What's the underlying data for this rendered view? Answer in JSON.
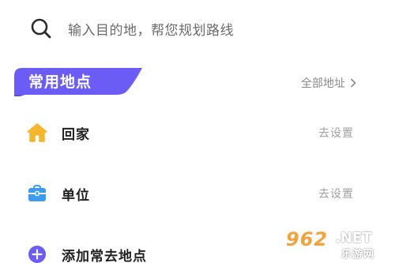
{
  "search": {
    "placeholder": "输入目的地，帮您规划路线",
    "icon": "search-icon"
  },
  "section": {
    "tab_label": "常用地点",
    "tab_color": "#6B5CF5",
    "all_label": "全部地址",
    "all_icon": "chevron-right-icon"
  },
  "places": [
    {
      "label": "回家",
      "action": "去设置",
      "icon": "home-icon",
      "icon_color": "#F6B62C"
    },
    {
      "label": "单位",
      "action": "去设置",
      "icon": "briefcase-icon",
      "icon_color": "#3D9BF0"
    }
  ],
  "add_place": {
    "label": "添加常去地点",
    "icon": "add-circle-icon",
    "icon_color": "#6B5CF5"
  },
  "watermark": {
    "num": "962",
    "net": ".NET",
    "cn": "乐游网"
  }
}
